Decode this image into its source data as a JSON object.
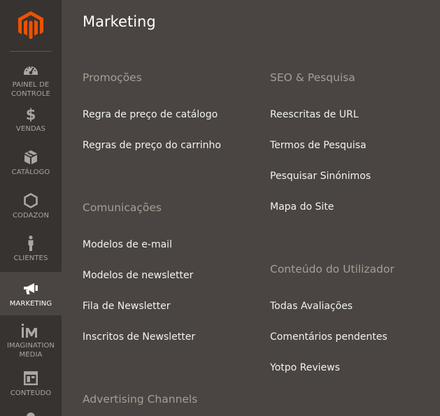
{
  "colors": {
    "sidebar_bg": "#373330",
    "panel_bg": "#4a4542",
    "accent_orange": "#eb5202",
    "group_title": "#a79d95",
    "link_text": "#f2f2f2",
    "nav_text": "#aaa6a0"
  },
  "sidebar": {
    "logo_icon": "magento-logo-icon",
    "items": [
      {
        "label": "PAINEL DE\nCONTROLE",
        "icon": "dashboard-icon",
        "active": false
      },
      {
        "label": "VENDAS",
        "icon": "dollar-icon",
        "active": false
      },
      {
        "label": "CATÁLOGO",
        "icon": "cube-icon",
        "active": false
      },
      {
        "label": "CODAZON",
        "icon": "hexagon-icon",
        "active": false
      },
      {
        "label": "CLIENTES",
        "icon": "person-icon",
        "active": false
      },
      {
        "label": "MARKETING",
        "icon": "megaphone-icon",
        "active": true
      },
      {
        "label": "IMAGINATION\nMEDIA",
        "icon": "im-logo-icon",
        "active": false
      },
      {
        "label": "CONTEÚDO",
        "icon": "layout-icon",
        "active": false
      }
    ]
  },
  "panel": {
    "title": "Marketing",
    "groups": [
      {
        "title": "Promoções",
        "links": [
          "Regra de preço de catálogo",
          "Regras de preço do carrinho"
        ]
      },
      {
        "title": "Comunicações",
        "links": [
          "Modelos de e-mail",
          "Modelos de newsletter",
          "Fila de Newsletter",
          "Inscritos de Newsletter"
        ]
      },
      {
        "title": "Advertising Channels",
        "links": []
      },
      {
        "title": "SEO & Pesquisa",
        "links": [
          "Reescritas de URL",
          "Termos de Pesquisa",
          "Pesquisar Sinónimos",
          "Mapa do Site"
        ]
      },
      {
        "title": "Conteúdo do Utilizador",
        "links": [
          "Todas Avaliações",
          "Comentários pendentes",
          "Yotpo Reviews"
        ]
      }
    ]
  }
}
